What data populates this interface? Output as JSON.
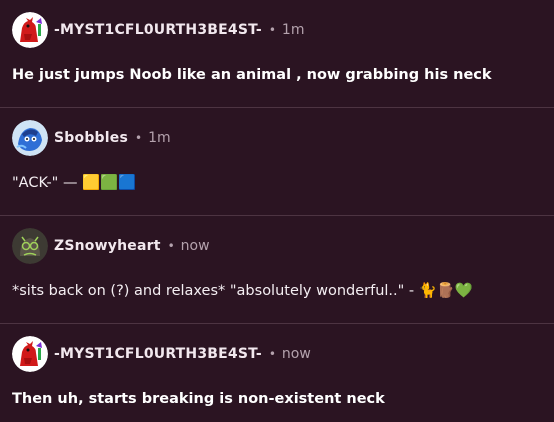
{
  "colors": {
    "background": "#2b1422",
    "divider": "#4d3442",
    "text": "#ffffff",
    "muted": "#b4a2ad"
  },
  "posts": [
    {
      "username": "-MYST1CFL0URTH3BE4ST-",
      "separator": "•",
      "time": "1m",
      "body": "He just jumps Noob like an animal , now grabbing his neck",
      "avatar_icon": "red-devil-avatar-icon"
    },
    {
      "username": "Sbobbles",
      "separator": "•",
      "time": "1m",
      "body": "\"ACK-\" — 🟨🟩🟦",
      "avatar_icon": "blue-character-avatar-icon"
    },
    {
      "username": "ZSnowyheart",
      "separator": "•",
      "time": "now",
      "body": "*sits back on (?) and relaxes* \"absolutely wonderful..\" - 🐈🪵💚",
      "avatar_icon": "dark-character-avatar-icon"
    },
    {
      "username": "-MYST1CFL0URTH3BE4ST-",
      "separator": "•",
      "time": "now",
      "body": "Then uh, starts breaking is non-existent neck",
      "avatar_icon": "red-devil-avatar-icon"
    }
  ]
}
